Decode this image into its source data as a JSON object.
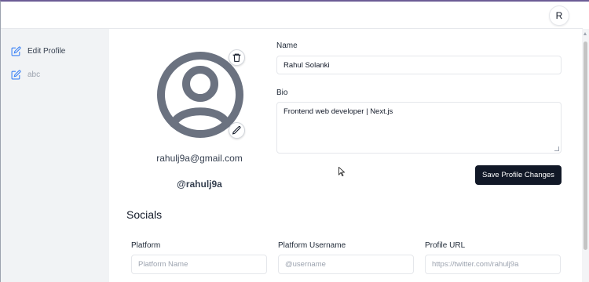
{
  "header": {
    "avatar_initial": "R"
  },
  "sidebar": {
    "items": [
      {
        "label": "Edit Profile",
        "icon": "edit-icon"
      },
      {
        "label": "abc",
        "icon": "edit-icon"
      }
    ]
  },
  "profile": {
    "email": "rahulj9a@gmail.com",
    "handle": "@rahulj9a",
    "avatar_icon": "user-circle-icon",
    "delete_icon": "trash-icon",
    "edit_icon": "pencil-icon"
  },
  "form": {
    "name_label": "Name",
    "name_value": "Rahul Solanki",
    "bio_label": "Bio",
    "bio_value": "Frontend web developer | Next.js",
    "save_label": "Save Profile Changes"
  },
  "socials": {
    "title": "Socials",
    "columns": [
      {
        "label": "Platform",
        "placeholder": "Platform Name"
      },
      {
        "label": "Platform Username",
        "placeholder": "@username"
      },
      {
        "label": "Profile URL",
        "placeholder": "https://twitter.com/rahulj9a"
      }
    ]
  },
  "colors": {
    "accent": "#111827",
    "sidebar_bg": "#f1f3f5",
    "avatar_gray": "#6b7280"
  }
}
